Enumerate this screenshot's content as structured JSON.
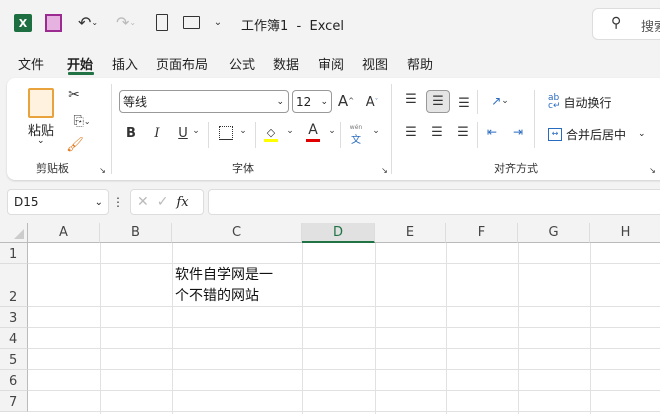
{
  "titlebar": {
    "title": "工作簿1  -  Excel",
    "search_placeholder": "搜索"
  },
  "tabs": [
    "文件",
    "开始",
    "插入",
    "页面布局",
    "公式",
    "数据",
    "审阅",
    "视图",
    "帮助"
  ],
  "active_tab": "开始",
  "ribbon": {
    "clipboard": {
      "paste": "粘贴",
      "group": "剪贴板"
    },
    "font": {
      "name": "等线",
      "size": "12",
      "bold": "B",
      "italic": "I",
      "underline": "U",
      "font_color": "A",
      "phonetic_top": "wén",
      "phonetic_bottom": "文",
      "grow": "A",
      "shrink": "A",
      "group": "字体",
      "fill_color": "#ffff00",
      "text_color": "#e00000"
    },
    "alignment": {
      "wrap": "自动换行",
      "merge": "合并后居中",
      "group": "对齐方式"
    }
  },
  "formula_bar": {
    "name_box": "D15",
    "fx": "fx",
    "value": ""
  },
  "sheet": {
    "columns": [
      "A",
      "B",
      "C",
      "D",
      "E",
      "F",
      "G",
      "H"
    ],
    "selected_column": "D",
    "rows": [
      "1",
      "2",
      "3",
      "4",
      "5",
      "6",
      "7"
    ],
    "cells": {
      "C2_line1": "软件自学网是一",
      "C2_line2": "个不错的网站"
    }
  },
  "colors": {
    "accent": "#217346",
    "save": "#c239b3"
  }
}
